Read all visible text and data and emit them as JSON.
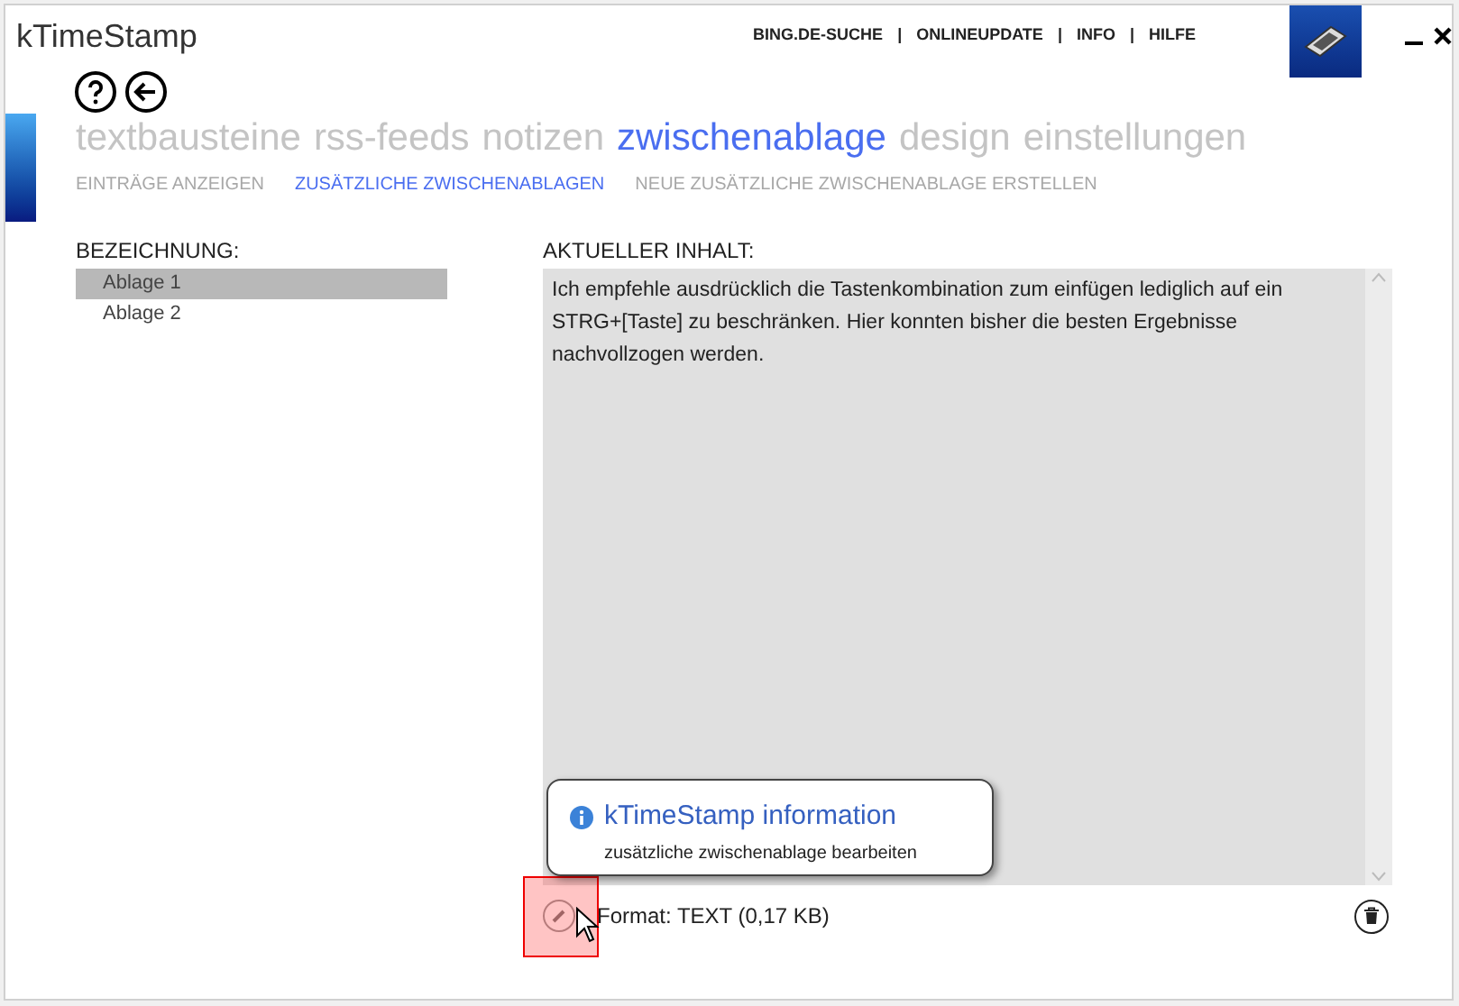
{
  "window": {
    "title": "kTimeStamp"
  },
  "top_links": [
    "BING.DE-SUCHE",
    "ONLINEUPDATE",
    "INFO",
    "HILFE"
  ],
  "link_separator": "|",
  "tabs": [
    {
      "label": "textbausteine",
      "selected": false
    },
    {
      "label": "rss-feeds",
      "selected": false
    },
    {
      "label": "notizen",
      "selected": false
    },
    {
      "label": "zwischenablage",
      "selected": true
    },
    {
      "label": "design",
      "selected": false
    },
    {
      "label": "einstellungen",
      "selected": false
    }
  ],
  "subtabs": [
    {
      "label": "EINTRÄGE ANZEIGEN",
      "selected": false
    },
    {
      "label": "ZUSÄTZLICHE ZWISCHENABLAGEN",
      "selected": true
    },
    {
      "label": "NEUE ZUSÄTZLICHE ZWISCHENABLAGE ERSTELLEN",
      "selected": false
    }
  ],
  "list": {
    "heading": "BEZEICHNUNG:",
    "items": [
      {
        "label": "Ablage 1",
        "selected": true
      },
      {
        "label": "Ablage 2",
        "selected": false
      }
    ]
  },
  "content": {
    "heading": "AKTUELLER INHALT:",
    "text": "Ich empfehle ausdrücklich die Tastenkombination zum einfügen lediglich auf ein STRG+[Taste] zu beschränken. Hier konnten bisher die besten Ergebnisse nachvollzogen werden.",
    "format": "Format: TEXT (0,17 KB)"
  },
  "tooltip": {
    "title": "kTimeStamp information",
    "text": "zusätzliche zwischenablage bearbeiten"
  }
}
